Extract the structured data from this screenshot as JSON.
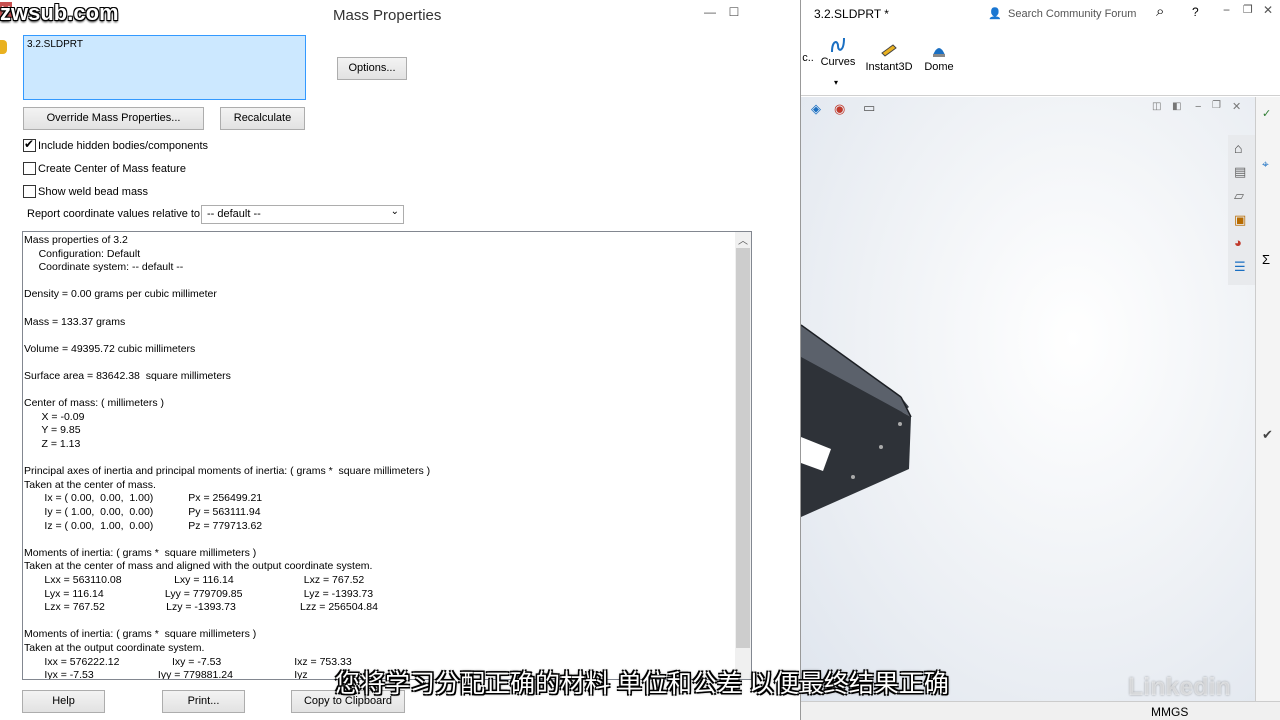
{
  "watermark": "zwsub.com",
  "dialog": {
    "title": "Mass Properties",
    "file_item": "3.2.SLDPRT",
    "options_button": "Options...",
    "override_button": "Override Mass Properties...",
    "recalculate_button": "Recalculate",
    "checkboxes": [
      {
        "label": "Include hidden bodies/components",
        "checked": true
      },
      {
        "label": "Create Center of Mass feature",
        "checked": false
      },
      {
        "label": "Show weld bead mass",
        "checked": false
      }
    ],
    "coord_label": "Report coordinate values relative to:",
    "coord_value": "-- default --",
    "help_button": "Help",
    "print_button": "Print...",
    "copy_button": "Copy to Clipboard",
    "results": [
      "Mass properties of 3.2",
      "     Configuration: Default",
      "     Coordinate system: -- default --",
      "",
      "Density = 0.00 grams per cubic millimeter",
      "",
      "Mass = 133.37 grams",
      "",
      "Volume = 49395.72 cubic millimeters",
      "",
      "Surface area = 83642.38  square millimeters",
      "",
      "Center of mass: ( millimeters )",
      "      X = -0.09",
      "      Y = 9.85",
      "      Z = 1.13",
      "",
      "Principal axes of inertia and principal moments of inertia: ( grams *  square millimeters )",
      "Taken at the center of mass.",
      "       Ix = ( 0.00,  0.00,  1.00)            Px = 256499.21",
      "       Iy = ( 1.00,  0.00,  0.00)            Py = 563111.94",
      "       Iz = ( 0.00,  1.00,  0.00)            Pz = 779713.62",
      "",
      "Moments of inertia: ( grams *  square millimeters )",
      "Taken at the center of mass and aligned with the output coordinate system.",
      "       Lxx = 563110.08                  Lxy = 116.14                        Lxz = 767.52",
      "       Lyx = 116.14                     Lyy = 779709.85                     Lyz = -1393.73",
      "       Lzx = 767.52                     Lzy = -1393.73                      Lzz = 256504.84",
      "",
      "Moments of inertia: ( grams *  square millimeters )",
      "Taken at the output coordinate system.",
      "       Ixx = 576222.12                  Ixy = -7.53                         Ixz = 753.33",
      "       Iyx = -7.53                      Iyy = 779881.24                     Iyz"
    ]
  },
  "app": {
    "doc_title": "3.2.SLDPRT *",
    "search_placeholder": "Search Community Forum",
    "ribbon": [
      {
        "label": "c.."
      },
      {
        "label": "Curves"
      },
      {
        "label": "Instant3D"
      },
      {
        "label": "Dome"
      }
    ],
    "status_units": "MMGS"
  },
  "subtitle": "您将学习分配正确的材料 单位和公差 以便最终结果正确",
  "logo": "Linkedin"
}
